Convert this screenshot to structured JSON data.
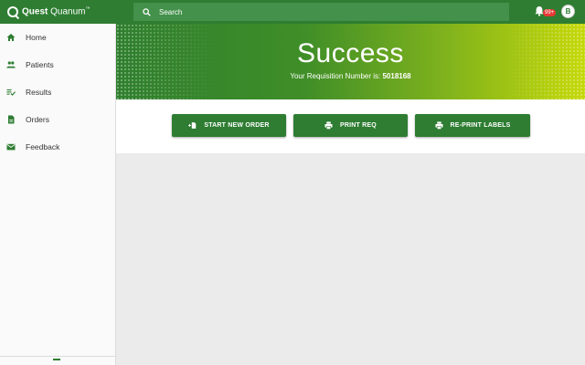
{
  "app": {
    "logo_bold": "Quest",
    "logo_light": "Quanum",
    "logo_tm": "™"
  },
  "search": {
    "placeholder": "Search"
  },
  "notifications": {
    "count": "99+"
  },
  "user": {
    "initial": "B"
  },
  "sidebar": {
    "items": [
      {
        "label": "Home",
        "icon": "home-icon"
      },
      {
        "label": "Patients",
        "icon": "people-icon"
      },
      {
        "label": "Results",
        "icon": "results-icon"
      },
      {
        "label": "Orders",
        "icon": "document-icon"
      },
      {
        "label": "Feedback",
        "icon": "mail-icon"
      }
    ]
  },
  "hero": {
    "title": "Success",
    "subtitle": "Your Requisition Number is:",
    "requisition_number": "5018168"
  },
  "actions": {
    "start_new_order": "START NEW ORDER",
    "print_req": "PRINT REQ",
    "reprint_labels": "RE-PRINT LABELS"
  },
  "colors": {
    "brand_green": "#2e7d32",
    "hero_gradient_end": "#c6d909",
    "badge_red": "#e53935",
    "content_bg": "#ebebeb"
  }
}
